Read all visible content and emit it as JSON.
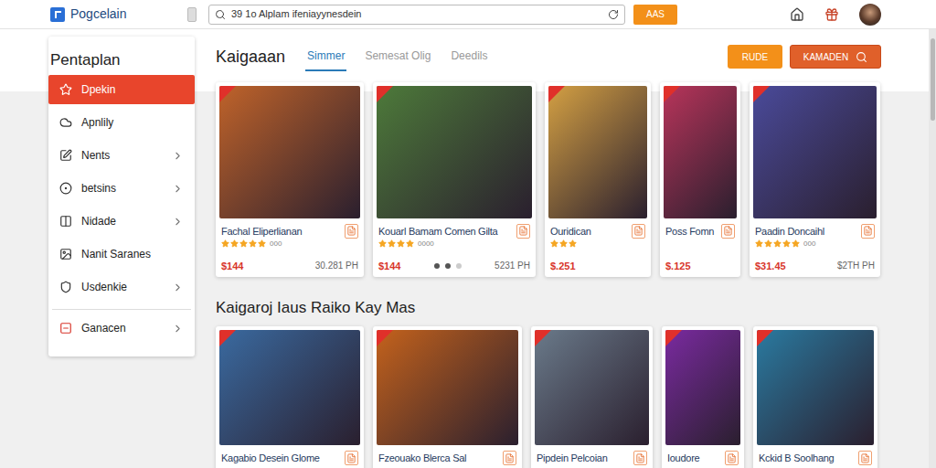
{
  "app": {
    "name": "Pogcelain"
  },
  "search": {
    "value": "39 1o Alplam ifeniayynesdein"
  },
  "search_button": "AAS",
  "sidebar": {
    "title": "Pentaplan",
    "items": [
      {
        "label": "Dpekin",
        "selected": true,
        "has_submenu": false,
        "separator_before": false
      },
      {
        "label": "Apnlily",
        "selected": false,
        "has_submenu": false,
        "separator_before": false
      },
      {
        "label": "Nents",
        "selected": false,
        "has_submenu": true,
        "separator_before": false
      },
      {
        "label": "betsins",
        "selected": false,
        "has_submenu": true,
        "separator_before": false
      },
      {
        "label": "Nidade",
        "selected": false,
        "has_submenu": true,
        "separator_before": false
      },
      {
        "label": "Nanit Saranes",
        "selected": false,
        "has_submenu": false,
        "separator_before": false
      },
      {
        "label": "Usdenkie",
        "selected": false,
        "has_submenu": true,
        "separator_before": false
      },
      {
        "label": "Ganacen",
        "selected": false,
        "has_submenu": true,
        "separator_before": true
      }
    ]
  },
  "header": {
    "title": "Kaigaaan",
    "tabs": [
      {
        "label": "Simmer",
        "selected": true
      },
      {
        "label": "Semesat Olig",
        "selected": false
      },
      {
        "label": "Deedils",
        "selected": false
      }
    ],
    "buttons": [
      "RUDE",
      "KAMADEN"
    ]
  },
  "featured": [
    {
      "title": "Fachal Eliperlianan",
      "stars": 5,
      "rating_text": "000",
      "price": "$144",
      "extra": "30.281 PH",
      "dots": [],
      "color": "#c0632a"
    },
    {
      "title": "Kouarl Bamam Comen Gilta",
      "stars": 4,
      "rating_text": "0000",
      "price": "$144",
      "extra": "5231 PH",
      "dots": [
        {
          "selected": true
        },
        {
          "selected": true
        },
        {
          "selected": false
        }
      ],
      "color": "#4d7a3a"
    },
    {
      "title": "Ouridican",
      "stars": 3,
      "rating_text": "",
      "price": "$.251",
      "extra": "",
      "dots": [],
      "color": "#d4a043"
    },
    {
      "title": "Poss Fomn",
      "stars": 0,
      "rating_text": "",
      "price": "$.125",
      "extra": "",
      "dots": [],
      "color": "#b8345a"
    },
    {
      "title": "Paadin Doncaihl",
      "stars": 5,
      "rating_text": "000",
      "price": "$31.45",
      "extra": "$2TH PH",
      "dots": [],
      "color": "#4a4a9a"
    }
  ],
  "section": {
    "title": "Kaigaroj Iaus Raiko Kay Mas",
    "cards": [
      {
        "title": "Kagabio Desein Glome",
        "color": "#3a6aa0"
      },
      {
        "title": "Fzeouako Blerca Sal",
        "color": "#c4621c"
      },
      {
        "title": "Pipdein Pelcoian",
        "color": "#6a7a8a"
      },
      {
        "title": "Ioudore",
        "color": "#7a2aa0"
      },
      {
        "title": "Kckid B Soolhang",
        "color": "#2a7aa0"
      }
    ]
  }
}
